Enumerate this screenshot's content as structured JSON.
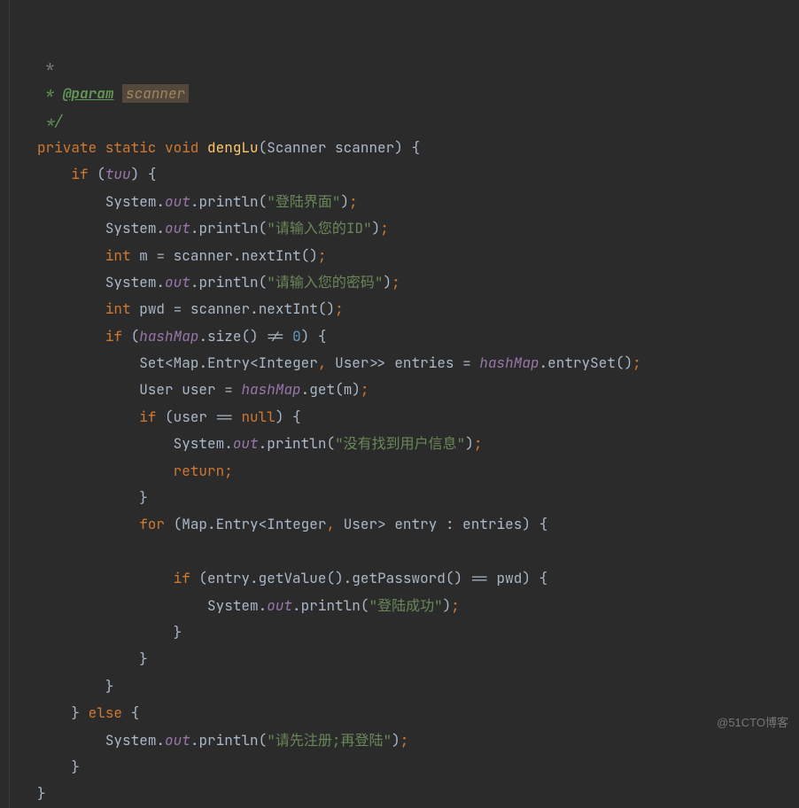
{
  "doc": {
    "tag": "@param",
    "param": "scanner",
    "close": "*/"
  },
  "sig": {
    "mods": "private static void",
    "name": "dengLu",
    "ptype": "Scanner",
    "pname": "scanner"
  },
  "kw": {
    "if": "if",
    "else": "else",
    "int": "int",
    "return": "return",
    "for": "for",
    "null": "null"
  },
  "ids": {
    "tuu": "tuu",
    "System": "System",
    "out": "out",
    "println": "println",
    "scanner": "scanner",
    "nextInt": "nextInt",
    "m": "m",
    "pwd": "pwd",
    "hashMap": "hashMap",
    "size": "size",
    "entrySet": "entrySet",
    "get": "get",
    "user": "user",
    "entries": "entries",
    "entry": "entry",
    "getValue": "getValue",
    "getPassword": "getPassword",
    "Set": "Set",
    "Map": "Map",
    "Entry": "Entry",
    "Integer": "Integer",
    "User": "User"
  },
  "str": {
    "s1": "\"登陆界面\"",
    "s2": "\"请输入您的ID\"",
    "s3": "\"请输入您的密码\"",
    "s4": "\"没有找到用户信息\"",
    "s5": "\"登陆成功\"",
    "s6": "\"请先注册;再登陆\""
  },
  "num": {
    "zero": "0"
  },
  "watermark": "@51CTO博客"
}
